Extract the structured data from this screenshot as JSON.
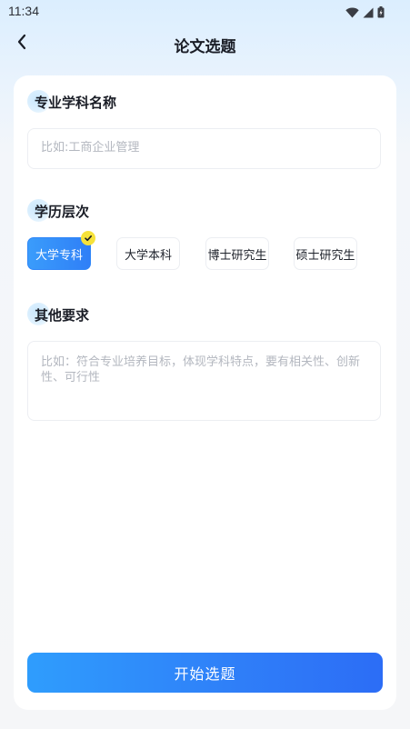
{
  "status_bar": {
    "time": "11:34",
    "icons": [
      "wifi-icon",
      "cellular-signal-icon",
      "battery-icon"
    ]
  },
  "nav": {
    "title": "论文选题",
    "back_icon": "chevron-left-icon"
  },
  "form": {
    "major": {
      "label": "专业学科名称",
      "placeholder": "比如:工商企业管理"
    },
    "level": {
      "label": "学历层次",
      "options": [
        "大学专科",
        "大学本科",
        "博士研究生",
        "硕士研究生"
      ],
      "selected": "大学专科"
    },
    "requirements": {
      "label": "其他要求",
      "placeholder": "比如：符合专业培养目标，体现学科特点，要有相关性、创新性、可行性"
    },
    "submit_label": "开始选题"
  },
  "colors": {
    "accent": "#2f86f8",
    "badge": "#f6e23a",
    "placeholder": "#b3b7bf"
  }
}
